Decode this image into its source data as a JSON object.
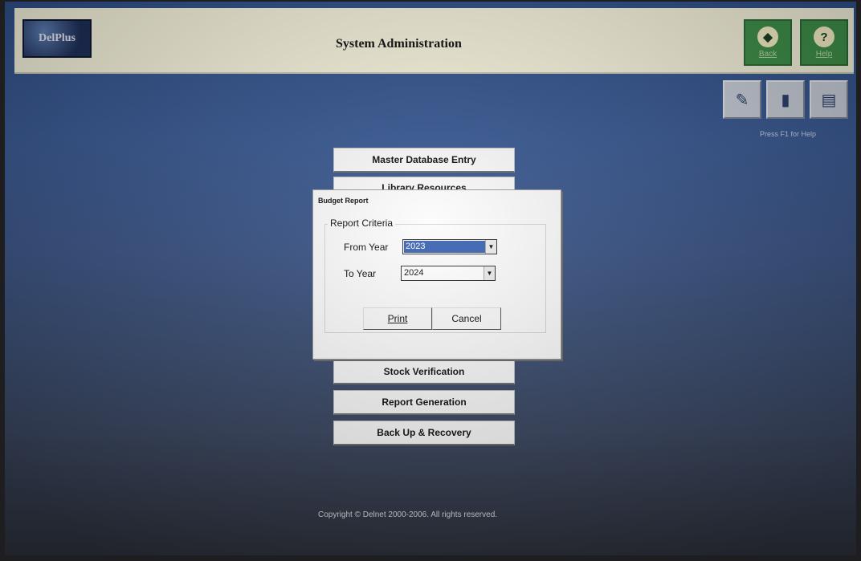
{
  "header": {
    "logo_text": "DelPlus",
    "title": "System Administration",
    "back_label": "Back",
    "help_label": "Help"
  },
  "toolbar": {
    "hint": "Press F1 for Help"
  },
  "menu": {
    "master_db": "Master Database Entry",
    "library_resources": "Library Resources",
    "stock_verification": "Stock Verification",
    "report_generation": "Report Generation",
    "backup_recovery": "Back Up & Recovery"
  },
  "dialog": {
    "title": "Budget Report",
    "group_label": "Report Criteria",
    "from_year_label": "From Year",
    "from_year_value": "2023",
    "to_year_label": "To Year",
    "to_year_value": "2024",
    "print_label": "Print",
    "cancel_label": "Cancel"
  },
  "footer": {
    "copyright": "Copyright © Delnet 2000-2006. All rights reserved."
  }
}
